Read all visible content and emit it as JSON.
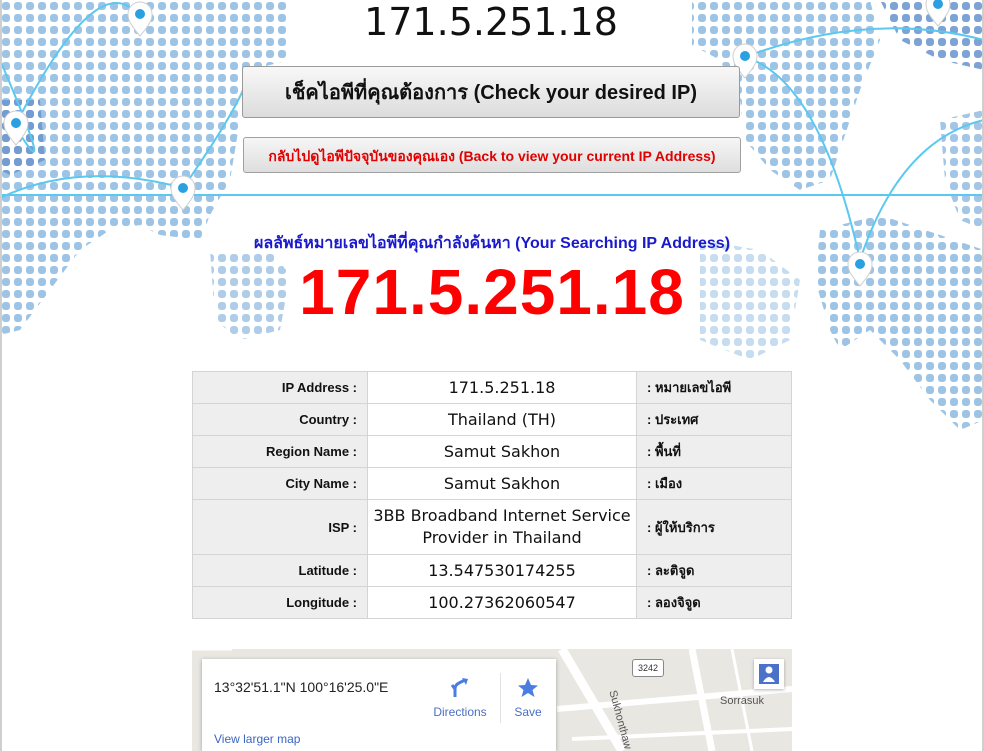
{
  "header": {
    "top_ip": "171.5.251.18"
  },
  "buttons": {
    "check_ip": "เช็คไอพีที่คุณต้องการ (Check your desired IP)",
    "back": "กลับไปดูไอพีปัจจุบันของคุณเอง (Back to view your current IP Address)"
  },
  "result": {
    "heading": "ผลลัพธ์หมายเลขไอพีที่คุณกำลังค้นหา (Your Searching IP Address)",
    "ip": "171.5.251.18"
  },
  "table": {
    "rows": [
      {
        "label": "IP Address :",
        "value": "171.5.251.18",
        "thai": ": หมายเลขไอพี"
      },
      {
        "label": "Country :",
        "value": "Thailand (TH)",
        "thai": ": ประเทศ"
      },
      {
        "label": "Region Name :",
        "value": "Samut Sakhon",
        "thai": ": พื้นที่"
      },
      {
        "label": "City Name :",
        "value": "Samut Sakhon",
        "thai": ": เมือง"
      },
      {
        "label": "ISP :",
        "value": "3BB Broadband Internet Service Provider in Thailand",
        "thai": ": ผู้ให้บริการ"
      },
      {
        "label": "Latitude :",
        "value": "13.547530174255",
        "thai": ": ละติจูด"
      },
      {
        "label": "Longitude :",
        "value": "100.27362060547",
        "thai": ": ลองจิจูด"
      }
    ]
  },
  "map": {
    "coords": "13°32'51.1\"N 100°16'25.0\"E",
    "directions_label": "Directions",
    "save_label": "Save",
    "larger_map_label": "View larger map",
    "road_shield": "3242",
    "road_labels": [
      "Sukhonthaw",
      "Sorrasuk"
    ]
  },
  "colors": {
    "accent_blue": "#1a1acc",
    "result_red": "#ff0000",
    "back_red": "#e00000",
    "map_dots": "#7fb2e0",
    "route_lines": "#5bc8f0",
    "pin": "#2aa0e0"
  }
}
